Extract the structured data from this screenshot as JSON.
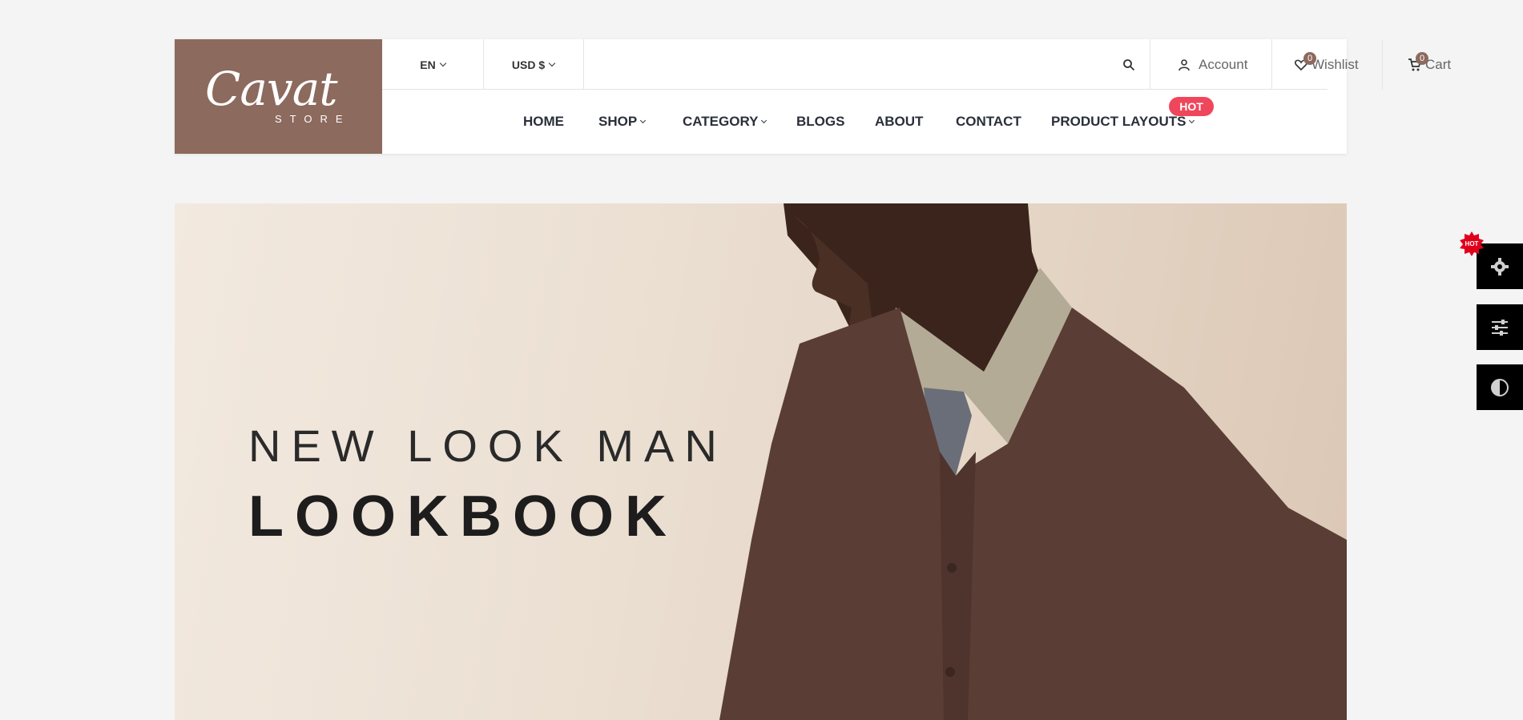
{
  "logo": {
    "main": "Cavat",
    "sub": "STORE"
  },
  "topbar": {
    "language": "EN",
    "currency": "USD $",
    "account_label": "Account",
    "wishlist_label": "Wishlist",
    "wishlist_count": "0",
    "cart_label": "Cart",
    "cart_count": "0"
  },
  "nav": {
    "items": [
      {
        "label": "HOME"
      },
      {
        "label": "SHOP"
      },
      {
        "label": "CATEGORY"
      },
      {
        "label": "BLOGS"
      },
      {
        "label": "ABOUT"
      },
      {
        "label": "CONTACT"
      },
      {
        "label": "PRODUCT LAYOUTS"
      }
    ],
    "hot_badge": "HOT"
  },
  "hero": {
    "subtitle": "NEW LOOK MAN",
    "title": "LOOKBOOK"
  },
  "side": {
    "hot_label": "HOT",
    "buttons": [
      "gear-icon",
      "sliders-icon",
      "contrast-icon"
    ]
  },
  "colors": {
    "brand": "#8c6a5d",
    "hot": "#f0465b",
    "hero_bg": "#ebdfd2",
    "sweater": "#5a3d35"
  }
}
